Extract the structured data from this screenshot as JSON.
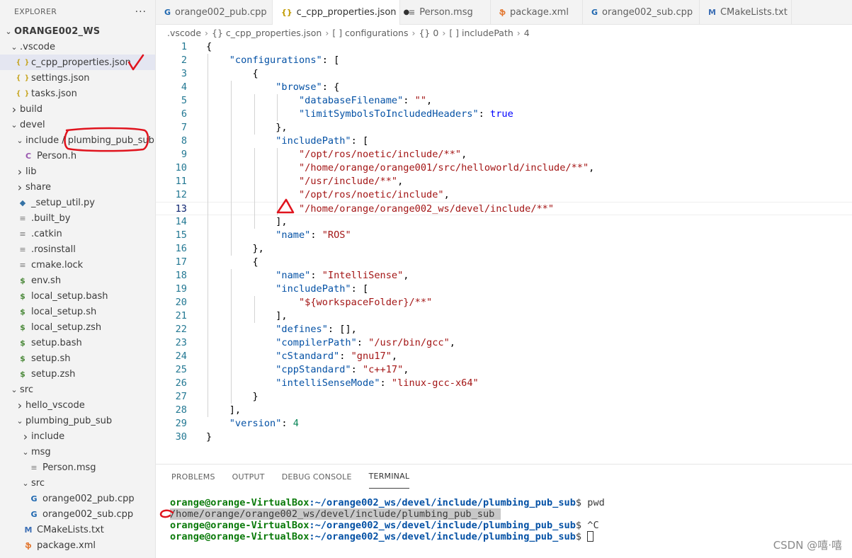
{
  "explorer": {
    "title": "EXPLORER",
    "more": "···",
    "root": "ORANGE002_WS",
    "items": [
      {
        "label": ".vscode",
        "depth": 1,
        "kind": "folder-open"
      },
      {
        "label": "c_cpp_properties.json",
        "depth": 2,
        "kind": "json",
        "selected": true
      },
      {
        "label": "settings.json",
        "depth": 2,
        "kind": "json"
      },
      {
        "label": "tasks.json",
        "depth": 2,
        "kind": "json"
      },
      {
        "label": "build",
        "depth": 1,
        "kind": "folder"
      },
      {
        "label": "devel",
        "depth": 1,
        "kind": "folder-open"
      },
      {
        "label": "include / plumbing_pub_sub",
        "depth": 2,
        "kind": "folder-open"
      },
      {
        "label": "Person.h",
        "depth": 3,
        "kind": "h"
      },
      {
        "label": "lib",
        "depth": 2,
        "kind": "folder"
      },
      {
        "label": "share",
        "depth": 2,
        "kind": "folder"
      },
      {
        "label": "_setup_util.py",
        "depth": 2,
        "kind": "py"
      },
      {
        "label": ".built_by",
        "depth": 2,
        "kind": "file"
      },
      {
        "label": ".catkin",
        "depth": 2,
        "kind": "file"
      },
      {
        "label": ".rosinstall",
        "depth": 2,
        "kind": "file"
      },
      {
        "label": "cmake.lock",
        "depth": 2,
        "kind": "file"
      },
      {
        "label": "env.sh",
        "depth": 2,
        "kind": "sh"
      },
      {
        "label": "local_setup.bash",
        "depth": 2,
        "kind": "sh"
      },
      {
        "label": "local_setup.sh",
        "depth": 2,
        "kind": "sh"
      },
      {
        "label": "local_setup.zsh",
        "depth": 2,
        "kind": "sh"
      },
      {
        "label": "setup.bash",
        "depth": 2,
        "kind": "sh"
      },
      {
        "label": "setup.sh",
        "depth": 2,
        "kind": "sh"
      },
      {
        "label": "setup.zsh",
        "depth": 2,
        "kind": "sh"
      },
      {
        "label": "src",
        "depth": 1,
        "kind": "folder-open"
      },
      {
        "label": "hello_vscode",
        "depth": 2,
        "kind": "folder"
      },
      {
        "label": "plumbing_pub_sub",
        "depth": 2,
        "kind": "folder-open"
      },
      {
        "label": "include",
        "depth": 3,
        "kind": "folder"
      },
      {
        "label": "msg",
        "depth": 3,
        "kind": "folder-open"
      },
      {
        "label": "Person.msg",
        "depth": 4,
        "kind": "file"
      },
      {
        "label": "src",
        "depth": 3,
        "kind": "folder-open"
      },
      {
        "label": "orange002_pub.cpp",
        "depth": 4,
        "kind": "cpp"
      },
      {
        "label": "orange002_sub.cpp",
        "depth": 4,
        "kind": "cpp"
      },
      {
        "label": "CMakeLists.txt",
        "depth": 3,
        "kind": "cmake"
      },
      {
        "label": "package.xml",
        "depth": 3,
        "kind": "xml"
      }
    ]
  },
  "tabs": [
    {
      "label": "orange002_pub.cpp",
      "icon": "cpp-icon",
      "active": false
    },
    {
      "label": "c_cpp_properties.json",
      "icon": "json-icon",
      "active": true,
      "modified": true
    },
    {
      "label": "Person.msg",
      "icon": "file-icon",
      "active": false
    },
    {
      "label": "package.xml",
      "icon": "xml-icon",
      "active": false
    },
    {
      "label": "orange002_sub.cpp",
      "icon": "cpp-icon",
      "active": false
    },
    {
      "label": "CMakeLists.txt",
      "icon": "cmake-icon",
      "active": false
    }
  ],
  "breadcrumb": [
    ".vscode",
    "{} c_cpp_properties.json",
    "[ ] configurations",
    "{} 0",
    "[ ] includePath",
    "4"
  ],
  "editor": {
    "current_line": 13,
    "lines": [
      [
        [
          "p",
          "{"
        ]
      ],
      [
        [
          "p",
          "    "
        ],
        [
          "k",
          "\"configurations\""
        ],
        [
          "p",
          ": ["
        ]
      ],
      [
        [
          "p",
          "        {"
        ]
      ],
      [
        [
          "p",
          "            "
        ],
        [
          "k",
          "\"browse\""
        ],
        [
          "p",
          ": {"
        ]
      ],
      [
        [
          "p",
          "                "
        ],
        [
          "k",
          "\"databaseFilename\""
        ],
        [
          "p",
          ": "
        ],
        [
          "s",
          "\"\""
        ],
        [
          "p",
          ","
        ]
      ],
      [
        [
          "p",
          "                "
        ],
        [
          "k",
          "\"limitSymbolsToIncludedHeaders\""
        ],
        [
          "p",
          ": "
        ],
        [
          "b",
          "true"
        ]
      ],
      [
        [
          "p",
          "            },"
        ]
      ],
      [
        [
          "p",
          "            "
        ],
        [
          "k",
          "\"includePath\""
        ],
        [
          "p",
          ": ["
        ]
      ],
      [
        [
          "p",
          "                "
        ],
        [
          "s",
          "\"/opt/ros/noetic/include/**\""
        ],
        [
          "p",
          ","
        ]
      ],
      [
        [
          "p",
          "                "
        ],
        [
          "s",
          "\"/home/orange/orange001/src/helloworld/include/**\""
        ],
        [
          "p",
          ","
        ]
      ],
      [
        [
          "p",
          "                "
        ],
        [
          "s",
          "\"/usr/include/**\""
        ],
        [
          "p",
          ","
        ]
      ],
      [
        [
          "p",
          "                "
        ],
        [
          "s",
          "\"/opt/ros/noetic/include\""
        ],
        [
          "p",
          ","
        ]
      ],
      [
        [
          "p",
          "                "
        ],
        [
          "s",
          "\"/home/orange/orange002_ws/devel/include/**\""
        ]
      ],
      [
        [
          "p",
          "            ],"
        ]
      ],
      [
        [
          "p",
          "            "
        ],
        [
          "k",
          "\"name\""
        ],
        [
          "p",
          ": "
        ],
        [
          "s",
          "\"ROS\""
        ]
      ],
      [
        [
          "p",
          "        },"
        ]
      ],
      [
        [
          "p",
          "        {"
        ]
      ],
      [
        [
          "p",
          "            "
        ],
        [
          "k",
          "\"name\""
        ],
        [
          "p",
          ": "
        ],
        [
          "s",
          "\"IntelliSense\""
        ],
        [
          "p",
          ","
        ]
      ],
      [
        [
          "p",
          "            "
        ],
        [
          "k",
          "\"includePath\""
        ],
        [
          "p",
          ": ["
        ]
      ],
      [
        [
          "p",
          "                "
        ],
        [
          "s",
          "\"${workspaceFolder}/**\""
        ]
      ],
      [
        [
          "p",
          "            ],"
        ]
      ],
      [
        [
          "p",
          "            "
        ],
        [
          "k",
          "\"defines\""
        ],
        [
          "p",
          ": [],"
        ]
      ],
      [
        [
          "p",
          "            "
        ],
        [
          "k",
          "\"compilerPath\""
        ],
        [
          "p",
          ": "
        ],
        [
          "s",
          "\"/usr/bin/gcc\""
        ],
        [
          "p",
          ","
        ]
      ],
      [
        [
          "p",
          "            "
        ],
        [
          "k",
          "\"cStandard\""
        ],
        [
          "p",
          ": "
        ],
        [
          "s",
          "\"gnu17\""
        ],
        [
          "p",
          ","
        ]
      ],
      [
        [
          "p",
          "            "
        ],
        [
          "k",
          "\"cppStandard\""
        ],
        [
          "p",
          ": "
        ],
        [
          "s",
          "\"c++17\""
        ],
        [
          "p",
          ","
        ]
      ],
      [
        [
          "p",
          "            "
        ],
        [
          "k",
          "\"intelliSenseMode\""
        ],
        [
          "p",
          ": "
        ],
        [
          "s",
          "\"linux-gcc-x64\""
        ]
      ],
      [
        [
          "p",
          "        }"
        ]
      ],
      [
        [
          "p",
          "    ],"
        ]
      ],
      [
        [
          "p",
          "    "
        ],
        [
          "k",
          "\"version\""
        ],
        [
          "p",
          ": "
        ],
        [
          "n",
          "4"
        ]
      ],
      [
        [
          "p",
          "}"
        ]
      ]
    ]
  },
  "panel": {
    "tabs": [
      "PROBLEMS",
      "OUTPUT",
      "DEBUG CONSOLE",
      "TERMINAL"
    ],
    "active_tab": "TERMINAL",
    "terminal": [
      {
        "user": "orange@orange-VirtualBox",
        "path": ":~/orange002_ws/devel/include/plumbing_pub_sub",
        "cmd": "$ pwd"
      },
      {
        "output": "/home/orange/orange002_ws/devel/include/plumbing_pub_sub "
      },
      {
        "user": "orange@orange-VirtualBox",
        "path": ":~/orange002_ws/devel/include/plumbing_pub_sub",
        "cmd": "$ ^C"
      },
      {
        "user": "orange@orange-VirtualBox",
        "path": ":~/orange002_ws/devel/include/plumbing_pub_sub",
        "cmd": "$ ",
        "cursor": true
      }
    ]
  },
  "watermark": "CSDN @嘻·嘻",
  "colors": {
    "annotation": "#e0141e",
    "selection": "#e4e6f1"
  }
}
